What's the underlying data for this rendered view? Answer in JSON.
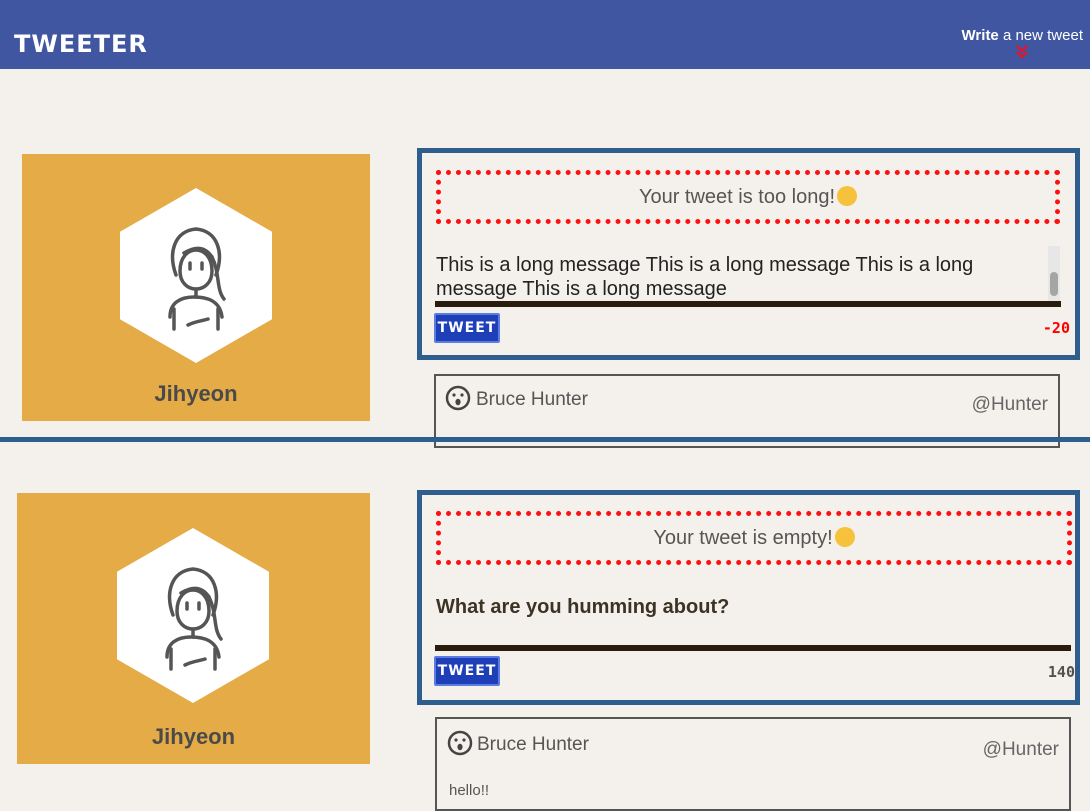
{
  "nav": {
    "logo": "TWEETER",
    "write_bold": "Write",
    "write_rest": " a new tweet",
    "chevron_icon": "double-chevron-down-icon"
  },
  "sections": [
    {
      "profile": {
        "name": "Jihyeon",
        "avatar_icon": "woman-avatar-icon"
      },
      "compose": {
        "error": "Your tweet is too long!",
        "error_emoji": "face-with-monocle-emoji",
        "text": "This is a long message This is a long message This is a long message This is a long message",
        "button": "TWEET",
        "counter": "-20",
        "counter_color": "#ff0000"
      },
      "tweet": {
        "user": "Bruce Hunter",
        "handle": "@Hunter",
        "text": ""
      }
    },
    {
      "profile": {
        "name": "Jihyeon",
        "avatar_icon": "woman-avatar-icon"
      },
      "compose": {
        "error": "Your tweet is empty!",
        "error_emoji": "thinking-face-emoji",
        "placeholder": "What are you humming about?",
        "button": "TWEET",
        "counter": "140",
        "counter_color": "#545149"
      },
      "tweet": {
        "user": "Bruce Hunter",
        "handle": "@Hunter",
        "text": "hello!!"
      }
    }
  ],
  "colors": {
    "nav": "#4056a1",
    "profile_bg": "#e5ab47",
    "compose_border": "#2d5e8e",
    "error_dots": "#ff1010",
    "button": "#1f3fb8"
  }
}
